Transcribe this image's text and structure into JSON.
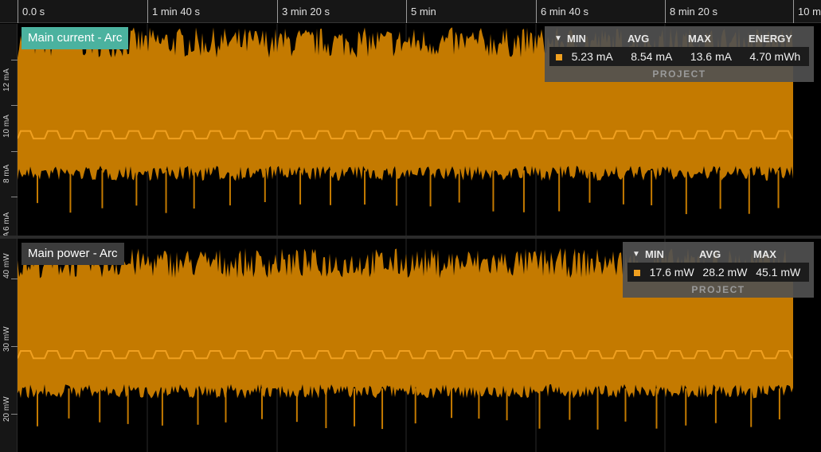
{
  "time_axis": {
    "ticks": [
      "0.0 s",
      "1 min 40 s",
      "3 min 20 s",
      "5 min",
      "6 min 40 s",
      "8 min 20 s",
      "10 m"
    ]
  },
  "colors": {
    "trace": "#c47a00",
    "trace_line": "#f0a020",
    "current_chip": "#4bb29f",
    "power_chip": "#3c3c3c"
  },
  "current_chart": {
    "label": "Main current - Arc",
    "y_ticks": [
      "12 mA",
      "10 mA",
      "8 mA",
      "6 mA",
      "A"
    ],
    "stats": {
      "toggle_icon": "triangle-down-icon",
      "headers": [
        "MIN",
        "AVG",
        "MAX",
        "ENERGY"
      ],
      "values": [
        "5.23 mA",
        "8.54 mA",
        "13.6 mA",
        "4.70 mWh"
      ],
      "scope": "PROJECT"
    }
  },
  "power_chart": {
    "label": "Main power - Arc",
    "y_ticks": [
      "40 mW",
      "30 mW",
      "20 mW"
    ],
    "stats": {
      "toggle_icon": "triangle-down-icon",
      "headers": [
        "MIN",
        "AVG",
        "MAX"
      ],
      "values": [
        "17.6 mW",
        "28.2 mW",
        "45.1 mW"
      ],
      "scope": "PROJECT"
    }
  },
  "chart_data": [
    {
      "type": "area",
      "title": "Main current - Arc",
      "ylabel": "mA",
      "yticks": [
        "6 mA",
        "8 mA",
        "10 mA",
        "12 mA"
      ],
      "xticks": [
        "0.0 s",
        "1 min 40 s",
        "3 min 20 s",
        "5 min",
        "6 min 40 s",
        "8 min 20 s",
        "10 m"
      ],
      "envelope_min": 5.23,
      "envelope_max": 13.6,
      "average": 8.54,
      "grid": true
    },
    {
      "type": "area",
      "title": "Main power - Arc",
      "ylabel": "mW",
      "yticks": [
        "20 mW",
        "30 mW",
        "40 mW"
      ],
      "xticks": [
        "0.0 s",
        "1 min 40 s",
        "3 min 20 s",
        "5 min",
        "6 min 40 s",
        "8 min 20 s",
        "10 m"
      ],
      "envelope_min": 17.6,
      "envelope_max": 45.1,
      "average": 28.2,
      "grid": true
    }
  ]
}
